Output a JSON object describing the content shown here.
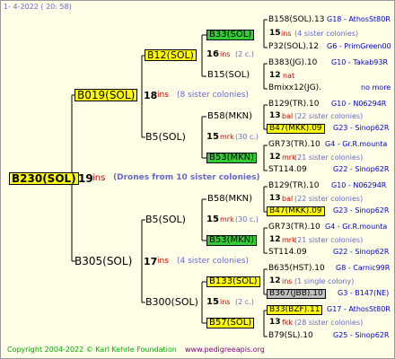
{
  "header": {
    "text": "1-  4-2022 ( 20: 58)"
  },
  "footer": {
    "copyright": "Copyright 2004-2022 © Karl Kehrle Foundation",
    "url": "www.pedigreeapis.org"
  },
  "root": {
    "name": "B230(SOL)",
    "num": "19",
    "unit": "ins",
    "note": "(Drones from 10 sister colonies)"
  },
  "g1": [
    {
      "name": "B019(SOL)",
      "num": "18",
      "unit": "ins",
      "note": "(8 sister colonies)"
    },
    {
      "name": "B305(SOL)",
      "num": "17",
      "unit": "ins",
      "note": "(4 sister colonies)"
    }
  ],
  "g2": [
    {
      "name": "B12(SOL)",
      "num": "16",
      "unit": "ins",
      "note": "(2 c.)"
    },
    {
      "name": "B5(SOL)",
      "num": "15",
      "unit": "mrk",
      "note": "(30 c.)"
    },
    {
      "name": "B5(SOL)",
      "num": "15",
      "unit": "mrk",
      "note": "(30 c.)"
    },
    {
      "name": "B300(SOL)",
      "num": "15",
      "unit": "ins",
      "note": "(2 c.)"
    }
  ],
  "g3": [
    {
      "name": "B33(SOL)",
      "num": "15",
      "unit": "ins",
      "note": "(4 sister colonies)"
    },
    {
      "name": "B15(SOL)",
      "num": "12",
      "unit": "nat",
      "note": ""
    },
    {
      "name": "B58(MKN)",
      "num": "13",
      "unit": "bal",
      "note": "(22 sister colonies)"
    },
    {
      "name": "B53(MKN)",
      "num": "12",
      "unit": "mrk",
      "note": "(21 sister colonies)"
    },
    {
      "name": "B58(MKN)",
      "num": "13",
      "unit": "bal",
      "note": "(22 sister colonies)"
    },
    {
      "name": "B53(MKN)",
      "num": "12",
      "unit": "mrk",
      "note": "(21 sister colonies)"
    },
    {
      "name": "B133(SOL)",
      "num": "12",
      "unit": "ins",
      "note": "(1 single colony)"
    },
    {
      "name": "B57(SOL)",
      "num": "13",
      "unit": "fkk",
      "note": "(28 sister colonies)"
    }
  ],
  "g4": [
    {
      "id": "B158(SOL).13",
      "info": "G18 - AthosSt80R"
    },
    {
      "id": "P32(SOL).12",
      "info": "G6 - PrimGreen00"
    },
    {
      "id": "B383(JG).10",
      "info": "G10 - Takab93R"
    },
    {
      "id": "Bmixx12(JG).",
      "info": "no more"
    },
    {
      "id": "B129(TR).10",
      "info": "G10 - N06294R"
    },
    {
      "id": "B47(MKK).09",
      "info": "G23 - Sinop62R"
    },
    {
      "id": "GR73(TR).10",
      "info": "G4 - Gr.R.mounta"
    },
    {
      "id": "ST114.09",
      "info": "G22 - Sinop62R"
    },
    {
      "id": "B129(TR).10",
      "info": "G10 - N06294R"
    },
    {
      "id": "B47(MKK).09",
      "info": "G23 - Sinop62R"
    },
    {
      "id": "GR73(TR).10",
      "info": "G4 - Gr.R.mounta"
    },
    {
      "id": "ST114.09",
      "info": "G22 - Sinop62R"
    },
    {
      "id": "B635(HST).10",
      "info": "G8 - Carnic99R"
    },
    {
      "id": "B367(JBB).10",
      "info": "G3 - B147(NE)"
    },
    {
      "id": "B33(BZF).11",
      "info": "G17 - AthosSt80R"
    },
    {
      "id": "B79(SL).10",
      "info": "G25 - Sinop62R"
    }
  ],
  "colors": {
    "frame_bg": "#ffffe8",
    "yellow": "#ffff00",
    "green": "#33cc33",
    "grey": "#c0c0c0",
    "red": "#cc0000",
    "blue": "#0000cc",
    "purple": "#800080"
  }
}
